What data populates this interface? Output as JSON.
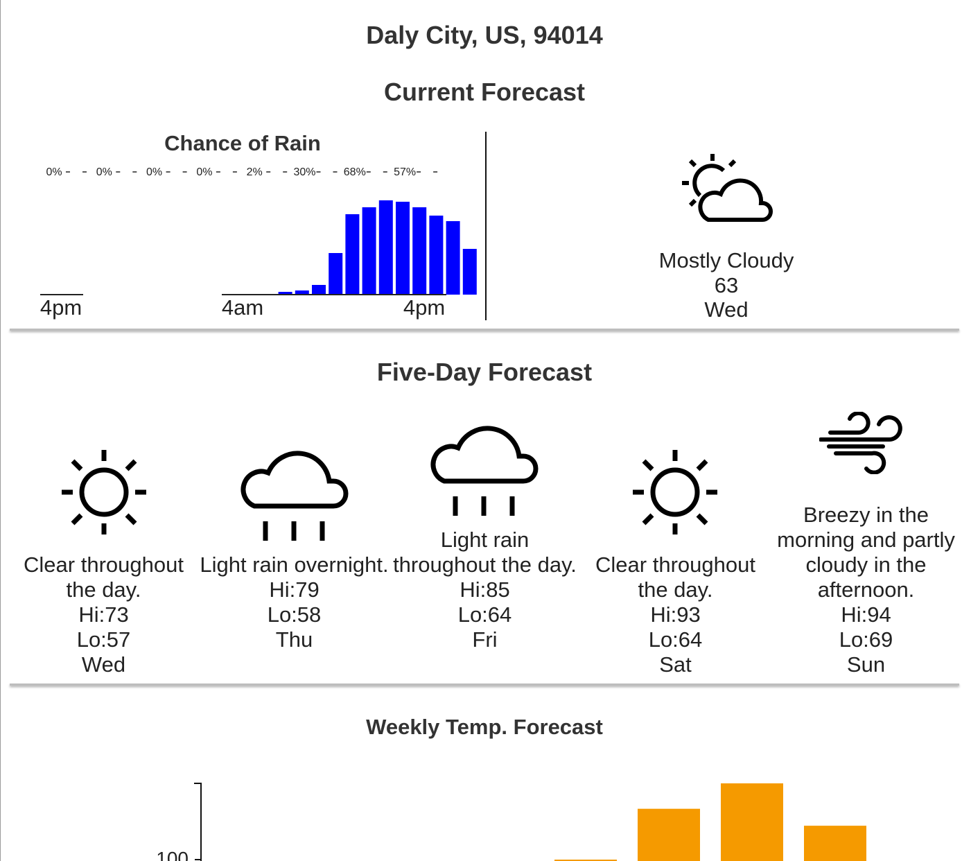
{
  "location": "Daly City, US, 94014",
  "current": {
    "heading": "Current Forecast",
    "condition": "Mostly Cloudy",
    "temperature": "63",
    "day": "Wed",
    "icon": "partly-cloudy-day-icon"
  },
  "chart_data": [
    {
      "type": "bar",
      "title": "Chance of Rain",
      "units": "%",
      "top_labels": [
        "0%",
        "0%",
        "0%",
        "0%",
        "2%",
        "30%",
        "68%",
        "57%"
      ],
      "x_tick_labels": [
        "4pm",
        "4am",
        "4pm"
      ],
      "bar_color": "#0000ff",
      "values": [
        0,
        0,
        0,
        2,
        3,
        7,
        30,
        58,
        63,
        68,
        67,
        63,
        57,
        53,
        33
      ],
      "ylim": [
        0,
        100
      ]
    },
    {
      "type": "bar",
      "title": "Weekly Temp. Forecast",
      "y_tick_labels": [
        "100"
      ],
      "bar_color": "#f59a00",
      "values": [
        null,
        null,
        null,
        null,
        100,
        112,
        118,
        108
      ]
    }
  ],
  "five_day": {
    "heading": "Five-Day Forecast",
    "days": [
      {
        "summary": "Clear throughout the day.",
        "hi": "Hi:73",
        "lo": "Lo:57",
        "day": "Wed",
        "icon": "sun-icon"
      },
      {
        "summary": "Light rain overnight.",
        "hi": "Hi:79",
        "lo": "Lo:58",
        "day": "Thu",
        "icon": "rain-icon"
      },
      {
        "summary": "Light rain throughout the day.",
        "hi": "Hi:85",
        "lo": "Lo:64",
        "day": "Fri",
        "icon": "rain-icon"
      },
      {
        "summary": "Clear throughout the day.",
        "hi": "Hi:93",
        "lo": "Lo:64",
        "day": "Sat",
        "icon": "sun-icon"
      },
      {
        "summary": "Breezy in the morning and partly cloudy in the afternoon.",
        "hi": "Hi:94",
        "lo": "Lo:69",
        "day": "Sun",
        "icon": "wind-icon"
      }
    ]
  },
  "colors": {
    "rain_bar": "#0000ff",
    "temp_bar": "#f59a00",
    "text": "#222222"
  }
}
